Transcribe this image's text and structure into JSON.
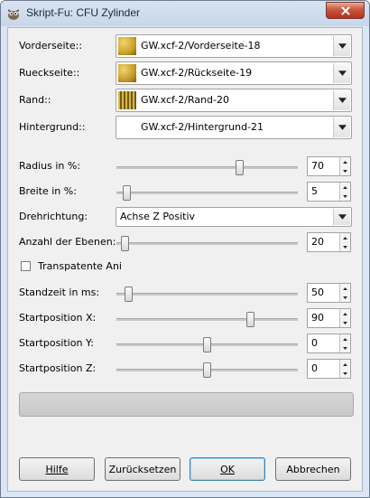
{
  "window": {
    "title": "Skript-Fu: CFU Zylinder",
    "close_icon": "close-icon"
  },
  "textures": [
    {
      "label": "Vorderseite::",
      "value": "GW.xcf-2/Vorderseite-18",
      "swatch_color": "#c9a227",
      "swatch_kind": "gold"
    },
    {
      "label": "Rueckseite::",
      "value": "GW.xcf-2/Rückseite-19",
      "swatch_color": "#c49a2a",
      "swatch_kind": "gold"
    },
    {
      "label": "Rand::",
      "value": "GW.xcf-2/Rand-20",
      "swatch_color": "#6e5a1a",
      "swatch_kind": "stripes"
    },
    {
      "label": "Hintergrund::",
      "value": "GW.xcf-2/Hintergrund-21",
      "swatch_color": "#ffffff",
      "swatch_kind": "white"
    }
  ],
  "sliders": [
    {
      "label": "Radius in %:",
      "value": "70",
      "fraction": 0.68
    },
    {
      "label": "Breite in %:",
      "value": "5",
      "fraction": 0.06
    },
    {
      "label": "Anzahl der Ebenen:",
      "value": "20",
      "fraction": 0.05
    }
  ],
  "direction": {
    "label": "Drehrichtung:",
    "value": "Achse Z Positiv"
  },
  "checkbox": {
    "label": "Transpatente Ani",
    "checked": false
  },
  "position_sliders": [
    {
      "label": "Standzeit in ms:",
      "value": "50",
      "fraction": 0.07
    },
    {
      "label": "Startposition X:",
      "value": "90",
      "fraction": 0.74
    },
    {
      "label": "Startposition Y:",
      "value": "0",
      "fraction": 0.5
    },
    {
      "label": "Startposition Z:",
      "value": "0",
      "fraction": 0.5
    }
  ],
  "buttons": {
    "help": "Hilfe",
    "reset": "Zurücksetzen",
    "ok": "OK",
    "cancel": "Abbrechen"
  }
}
